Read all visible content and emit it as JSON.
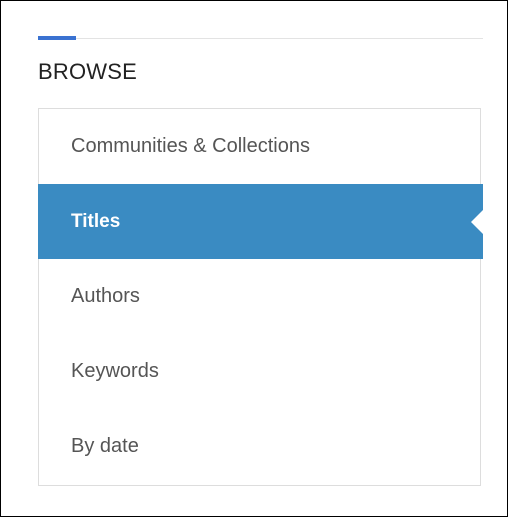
{
  "browse": {
    "title": "BROWSE",
    "items": [
      {
        "label": "Communities & Collections",
        "active": false
      },
      {
        "label": "Titles",
        "active": true
      },
      {
        "label": "Authors",
        "active": false
      },
      {
        "label": "Keywords",
        "active": false
      },
      {
        "label": "By date",
        "active": false
      }
    ]
  },
  "colors": {
    "accent": "#3a72d1",
    "active_background": "#3a8bc2",
    "active_text": "#ffffff",
    "item_text": "#555555"
  }
}
